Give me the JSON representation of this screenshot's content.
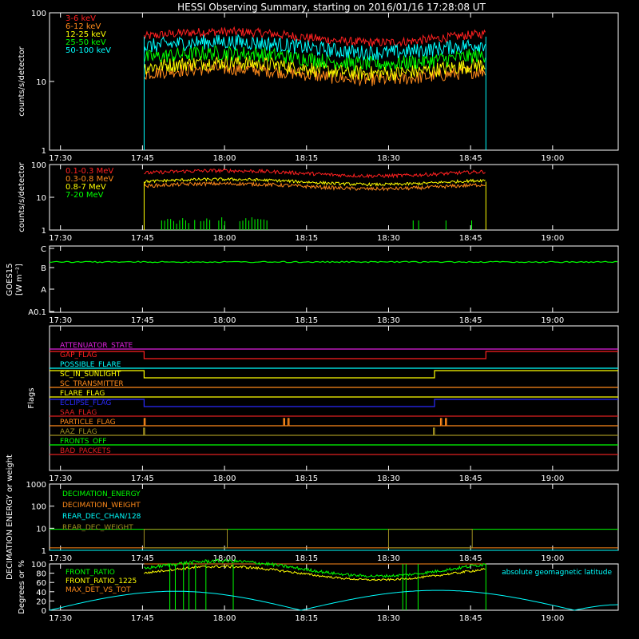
{
  "title": "HESSI Observing Summary, starting on 2016/01/16 17:28:08 UT",
  "time_axis": {
    "range_min": [
      0,
      104
    ],
    "tick_min": [
      2,
      17,
      32,
      47,
      62,
      77,
      92
    ],
    "tick_labels": [
      "17:30",
      "17:45",
      "18:00",
      "18:15",
      "18:30",
      "18:45",
      "19:00"
    ]
  },
  "colors": {
    "red": "#ff2020",
    "orange": "#ff8a1a",
    "yellow": "#ffff00",
    "green": "#00ff00",
    "cyan": "#00ffff",
    "blue": "#2a2aff",
    "magenta": "#e020e0",
    "dred": "#e02020",
    "olive": "#a09020",
    "frame": "#ffffff",
    "bg": "#000000"
  },
  "chart_data": [
    {
      "type": "line",
      "panel": "lightcurve_low",
      "ylabel": "counts/s/detector",
      "yscale": "log",
      "ylim": [
        1,
        100
      ],
      "y_tick_labels": [
        "1",
        "10",
        "100"
      ],
      "data_window_min": [
        17.3,
        79.8
      ],
      "series": [
        {
          "name": "3-6 keV",
          "color": "#ff2020",
          "level": 45,
          "spread": 0.06
        },
        {
          "name": "6-12 keV",
          "color": "#ff8a1a",
          "level": 13,
          "spread": 0.09
        },
        {
          "name": "12-25 keV",
          "color": "#ffff00",
          "level": 16,
          "spread": 0.1
        },
        {
          "name": "25-50 keV",
          "color": "#00ff00",
          "level": 22,
          "spread": 0.1
        },
        {
          "name": "50-100 keV",
          "color": "#00ffff",
          "level": 32,
          "spread": 0.1
        }
      ]
    },
    {
      "type": "line",
      "panel": "lightcurve_high",
      "ylabel": "counts/s/detector",
      "yscale": "log",
      "ylim": [
        1,
        100
      ],
      "y_tick_labels": [
        "1",
        "10",
        "100"
      ],
      "data_window_min": [
        17.3,
        79.8
      ],
      "series": [
        {
          "name": "0.1-0.3 MeV",
          "color": "#ff2020",
          "level": 55,
          "spread": 0.05
        },
        {
          "name": "0.3-0.8 MeV",
          "color": "#ff8a1a",
          "level": 22,
          "spread": 0.05
        },
        {
          "name": "0.8-7 MeV",
          "color": "#ffff00",
          "level": 30,
          "spread": 0.04
        },
        {
          "name": "7-20 MeV",
          "color": "#00ff00",
          "level": 1,
          "spread": 0
        }
      ]
    },
    {
      "type": "line",
      "panel": "goes",
      "ylabel": "GOES15",
      "yunit": "[W m⁻²]",
      "y_tick_labels": [
        "A0.1",
        "A",
        "B",
        "C"
      ],
      "series": [
        {
          "name": "GOES15",
          "color": "#00ff00",
          "level": "upper B"
        }
      ]
    },
    {
      "type": "line",
      "panel": "flags",
      "ylabel": "Flags",
      "series": [
        {
          "name": "ATTENUATOR_STATE",
          "color": "#e020e0",
          "transitions_min": []
        },
        {
          "name": "GAP_FLAG",
          "color": "#ff2020",
          "transitions_min": [
            17.3,
            79.8
          ]
        },
        {
          "name": "POSSIBLE_FLARE",
          "color": "#00ffff",
          "transitions_min": []
        },
        {
          "name": "SC_IN_SUNLIGHT",
          "color": "#ffff00",
          "transitions_min": [
            17.3,
            70.4
          ]
        },
        {
          "name": "SC_TRANSMITTER",
          "color": "#ff8a1a",
          "transitions_min": []
        },
        {
          "name": "FLARE_FLAG",
          "color": "#ffff00",
          "transitions_min": []
        },
        {
          "name": "ECLIPSE_FLAG",
          "color": "#2a2aff",
          "transitions_min": [
            17.3,
            70.4
          ]
        },
        {
          "name": "SAA_FLAG",
          "color": "#e02020",
          "transitions_min": []
        },
        {
          "name": "PARTICLE_FLAG",
          "color": "#ff8a1a",
          "transitions_min": [
            17.3,
            17.5,
            42.8,
            43.0,
            43.6,
            43.8,
            71.5,
            71.7,
            72.4,
            72.6
          ]
        },
        {
          "name": "AAZ_FLAG",
          "color": "#a09020",
          "transitions_min": [
            17.2,
            17.4,
            70.2,
            70.4
          ]
        },
        {
          "name": "FRONTS_OFF",
          "color": "#00ff00",
          "transitions_min": []
        },
        {
          "name": "BAD_PACKETS",
          "color": "#e02020",
          "transitions_min": []
        }
      ]
    },
    {
      "type": "line",
      "panel": "decimation",
      "ylabel": "DECIMATION ENERGY or weight",
      "yscale": "log",
      "ylim": [
        1,
        1000
      ],
      "y_tick_labels": [
        "1",
        "10",
        "100",
        "1000"
      ],
      "series": [
        {
          "name": "DECIMATION_ENERGY",
          "color": "#00ff00",
          "level": 9
        },
        {
          "name": "DECIMATION_WEIGHT",
          "color": "#ff8a1a",
          "level": 1.3
        },
        {
          "name": "REAR_DEC_CHAN/128",
          "color": "#00ffff",
          "level": 1
        },
        {
          "name": "REAR_DEC_WEIGHT",
          "color": "#a09020",
          "box_min": [
            [
              17.3,
              32.5
            ],
            [
              62.0,
              77.3
            ]
          ]
        }
      ]
    },
    {
      "type": "line",
      "panel": "ratios",
      "ylabel": "Degrees or %",
      "ylim": [
        0,
        100
      ],
      "y_tick_labels": [
        "0",
        "20",
        "40",
        "60",
        "80",
        "100"
      ],
      "series": [
        {
          "name": "FRONT_RATIO",
          "color": "#00ff00",
          "level": 90
        },
        {
          "name": "FRONT_RATIO_1225",
          "color": "#ffff00",
          "level": 80
        },
        {
          "name": "MAX_DET_VS_TOT",
          "color": "#ff8a1a",
          "level": 100
        },
        {
          "name": "absolute geomagnetic latitude",
          "color": "#00ffff",
          "peaks_min": [
            [
              25,
              41
            ],
            [
              62,
              43
            ]
          ],
          "zeros_min": [
            0,
            46,
            96
          ]
        }
      ]
    }
  ]
}
